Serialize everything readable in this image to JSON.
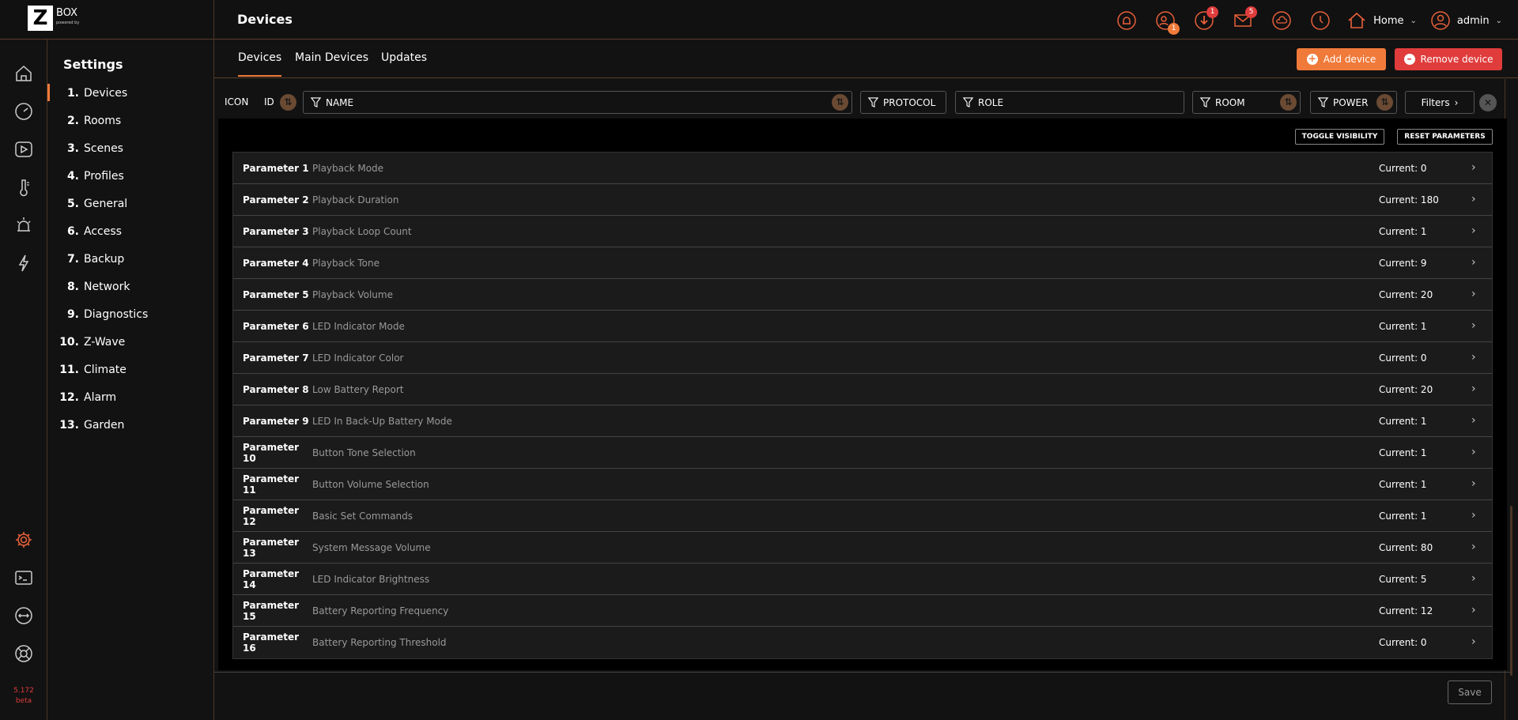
{
  "logo": {
    "letter": "Z",
    "brand": "BOX",
    "sub": "powered by"
  },
  "header": {
    "title": "Devices",
    "badges": {
      "users": "1",
      "download": "1",
      "mail": "5"
    },
    "home_label": "Home",
    "user_label": "admin"
  },
  "version": {
    "num": "5.172",
    "tag": "beta"
  },
  "settings": {
    "title": "Settings",
    "items": [
      {
        "num": "1.",
        "label": "Devices"
      },
      {
        "num": "2.",
        "label": "Rooms"
      },
      {
        "num": "3.",
        "label": "Scenes"
      },
      {
        "num": "4.",
        "label": "Profiles"
      },
      {
        "num": "5.",
        "label": "General"
      },
      {
        "num": "6.",
        "label": "Access"
      },
      {
        "num": "7.",
        "label": "Backup"
      },
      {
        "num": "8.",
        "label": "Network"
      },
      {
        "num": "9.",
        "label": "Diagnostics"
      },
      {
        "num": "10.",
        "label": "Z-Wave"
      },
      {
        "num": "11.",
        "label": "Climate"
      },
      {
        "num": "12.",
        "label": "Alarm"
      },
      {
        "num": "13.",
        "label": "Garden"
      }
    ]
  },
  "tabs": [
    "Devices",
    "Main Devices",
    "Updates"
  ],
  "actions": {
    "add": "Add device",
    "remove": "Remove device"
  },
  "filters": {
    "icon": "ICON",
    "id": "ID",
    "name": "NAME",
    "protocol": "PROTOCOL",
    "role": "ROLE",
    "room": "ROOM",
    "power": "POWER",
    "filters_btn": "Filters"
  },
  "panel": {
    "toggle": "TOGGLE VISIBILITY",
    "reset": "RESET PARAMETERS",
    "params": [
      {
        "name": "Parameter 1",
        "label": "Playback Mode",
        "current": "Current: 0"
      },
      {
        "name": "Parameter 2",
        "label": "Playback Duration",
        "current": "Current: 180"
      },
      {
        "name": "Parameter 3",
        "label": "Playback Loop Count",
        "current": "Current: 1"
      },
      {
        "name": "Parameter 4",
        "label": "Playback Tone",
        "current": "Current: 9"
      },
      {
        "name": "Parameter 5",
        "label": "Playback Volume",
        "current": "Current: 20"
      },
      {
        "name": "Parameter 6",
        "label": "LED Indicator Mode",
        "current": "Current: 1"
      },
      {
        "name": "Parameter 7",
        "label": "LED Indicator Color",
        "current": "Current: 0"
      },
      {
        "name": "Parameter 8",
        "label": "Low Battery Report",
        "current": "Current: 20"
      },
      {
        "name": "Parameter 9",
        "label": "LED In Back-Up Battery Mode",
        "current": "Current: 1"
      },
      {
        "name": "Parameter 10",
        "label": "Button Tone Selection",
        "current": "Current: 1"
      },
      {
        "name": "Parameter 11",
        "label": "Button Volume Selection",
        "current": "Current: 1"
      },
      {
        "name": "Parameter 12",
        "label": "Basic Set Commands",
        "current": "Current: 1"
      },
      {
        "name": "Parameter 13",
        "label": "System Message Volume",
        "current": "Current: 80"
      },
      {
        "name": "Parameter 14",
        "label": "LED Indicator Brightness",
        "current": "Current: 5"
      },
      {
        "name": "Parameter 15",
        "label": "Battery Reporting Frequency",
        "current": "Current: 12"
      },
      {
        "name": "Parameter 16",
        "label": "Battery Reporting Threshold",
        "current": "Current: 0"
      }
    ]
  },
  "save": "Save",
  "colors": {
    "accent": "#f07a3a",
    "danger": "#e03c3c",
    "bg": "#121212"
  }
}
